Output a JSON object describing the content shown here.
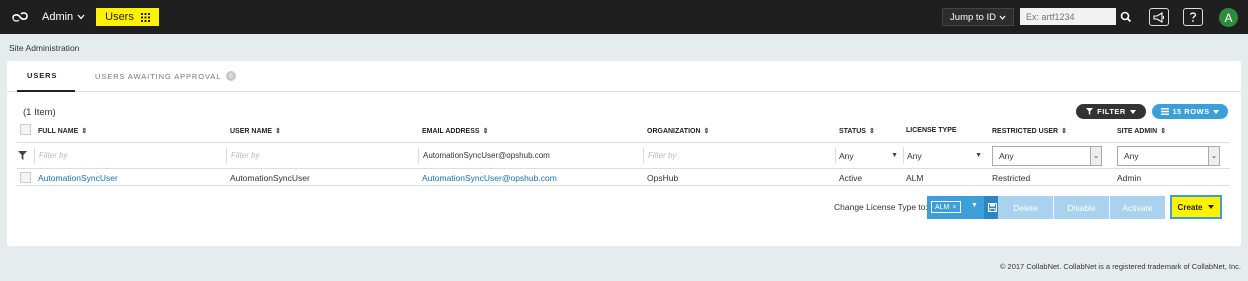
{
  "topbar": {
    "admin_label": "Admin",
    "users_label": "Users",
    "jump_label": "Jump to ID",
    "jump_placeholder": "Ex: artf1234",
    "avatar_letter": "A"
  },
  "breadcrumb": "Site Administration",
  "tabs": [
    {
      "label": "USERS",
      "active": true
    },
    {
      "label": "USERS AWAITING APPROVAL",
      "badge": "0"
    }
  ],
  "table": {
    "item_count": "(1 Item)",
    "filter_button": "FILTER",
    "rows_button": "15 ROWS",
    "columns": [
      "FULL NAME",
      "USER NAME",
      "EMAIL ADDRESS",
      "ORGANIZATION",
      "STATUS",
      "LICENSE TYPE",
      "RESTRICTED USER",
      "SITE ADMIN"
    ],
    "filters": {
      "placeholder": "Filter by",
      "email_value": "AutomationSyncUser@opshub.com",
      "status": "Any",
      "license_type": "Any",
      "restricted_user": "Any",
      "site_admin": "Any"
    },
    "rows": [
      {
        "full_name": "AutomationSyncUser",
        "user_name": "AutomationSyncUser",
        "email": "AutomationSyncUser@opshub.com",
        "organization": "OpsHub",
        "status": "Active",
        "license_type": "ALM",
        "restricted_user": "Restricted",
        "site_admin": "Admin"
      }
    ]
  },
  "actions": {
    "change_license_label": "Change License Type to:",
    "license_tag": "ALM",
    "delete_label": "Delete",
    "disable_label": "Disable",
    "activate_label": "Activate",
    "create_label": "Create"
  },
  "footer": "© 2017 CollabNet. CollabNet is a registered trademark of CollabNet, Inc.",
  "colors": {
    "accent_yellow": "#fff200",
    "accent_blue": "#3d9fd9",
    "topbar": "#1f1f1f",
    "link": "#1a6fb1"
  }
}
